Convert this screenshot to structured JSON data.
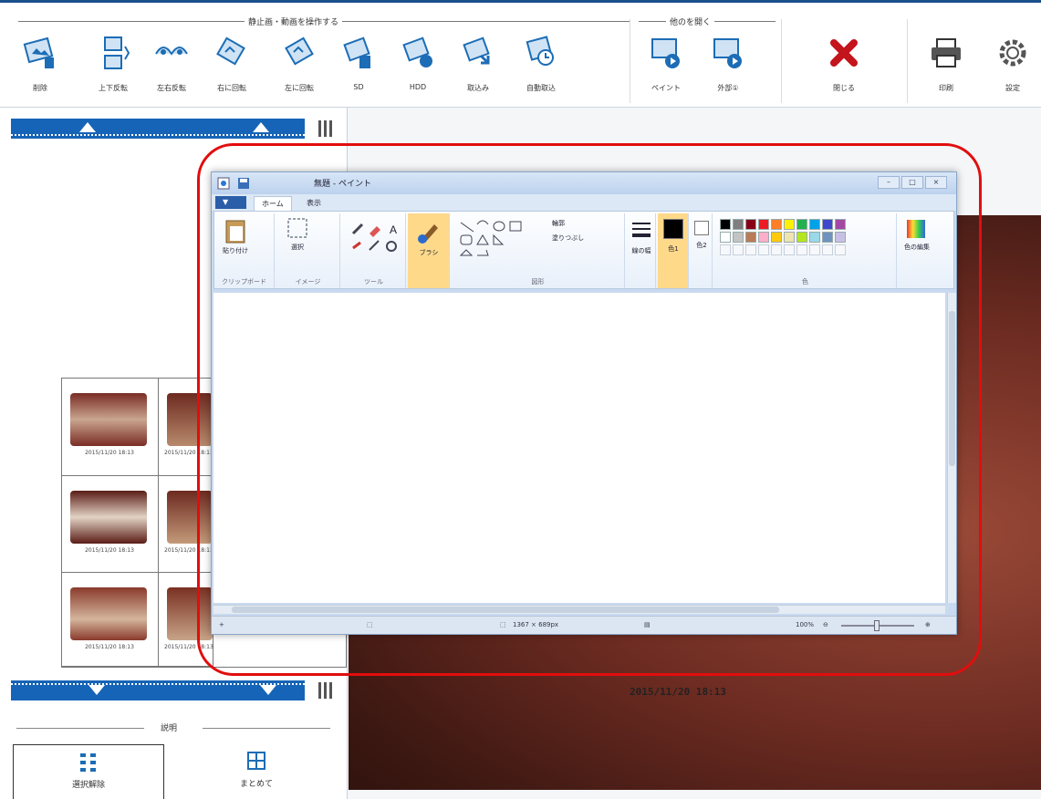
{
  "toolbar": {
    "group_still_video": "静止画・動画を操作する",
    "group_other": "他のを開く",
    "buttons": [
      {
        "label": "削除",
        "icon": "delete-image-icon"
      },
      {
        "label": "上下反転",
        "icon": "flip-vertical-icon"
      },
      {
        "label": "左右反転",
        "icon": "flip-horizontal-icon"
      },
      {
        "label": "右に回転",
        "icon": "rotate-right-icon"
      },
      {
        "label": "左に回転",
        "icon": "rotate-left-icon"
      },
      {
        "label": "SD",
        "icon": "sd-icon"
      },
      {
        "label": "HDD",
        "icon": "hdd-icon"
      },
      {
        "label": "取込み",
        "icon": "import-icon"
      },
      {
        "label": "自動取込",
        "icon": "auto-import-icon"
      },
      {
        "label": "ペイント",
        "icon": "paint-icon"
      },
      {
        "label": "外部①",
        "icon": "external-app-icon"
      },
      {
        "label": "閉じる",
        "icon": "close-icon"
      },
      {
        "label": "印刷",
        "icon": "print-icon"
      },
      {
        "label": "設定",
        "icon": "settings-icon"
      }
    ]
  },
  "left_panel": {
    "thumbnails": [
      {
        "timestamp": "2015/11/20 18:13"
      },
      {
        "timestamp": "2015/11/20 18:13"
      },
      {
        "timestamp": "2015/11/20 18:13"
      },
      {
        "timestamp": "2015/11/20 18:13"
      },
      {
        "timestamp": "2015/11/20 18:13"
      },
      {
        "timestamp": "2015/11/20 18:13"
      }
    ],
    "section_label": "説明",
    "button_deselect": "選択解除",
    "button_combine": "まとめて"
  },
  "viewer": {
    "timestamp": "2015/11/20 18:13"
  },
  "paint": {
    "title": "無題 - ペイント",
    "tabs": [
      "ホーム",
      "表示"
    ],
    "groups": {
      "clipboard": "クリップボード",
      "image": "イメージ",
      "tools": "ツール",
      "shapes": "図形",
      "colors": "色"
    },
    "paste_label": "貼り付け",
    "select_label": "選択",
    "brush_label": "ブラシ",
    "outline_label": "輪郭",
    "fill_label": "塗りつぶし",
    "line_width_label": "線の幅",
    "color1_label": "色1",
    "color2_label": "色2",
    "edit_colors_label": "色の編集",
    "status_size": "1367 × 689px",
    "zoom": "100%",
    "palette": [
      "#000000",
      "#7f7f7f",
      "#880015",
      "#ed1c24",
      "#ff7f27",
      "#fff200",
      "#22b14c",
      "#00a2e8",
      "#3f48cc",
      "#a349a4",
      "#ffffff",
      "#c3c3c3",
      "#b97a57",
      "#ffaec9",
      "#ffc90e",
      "#efe4b0",
      "#b5e61d",
      "#99d9ea",
      "#7092be",
      "#c8bfe7"
    ]
  }
}
